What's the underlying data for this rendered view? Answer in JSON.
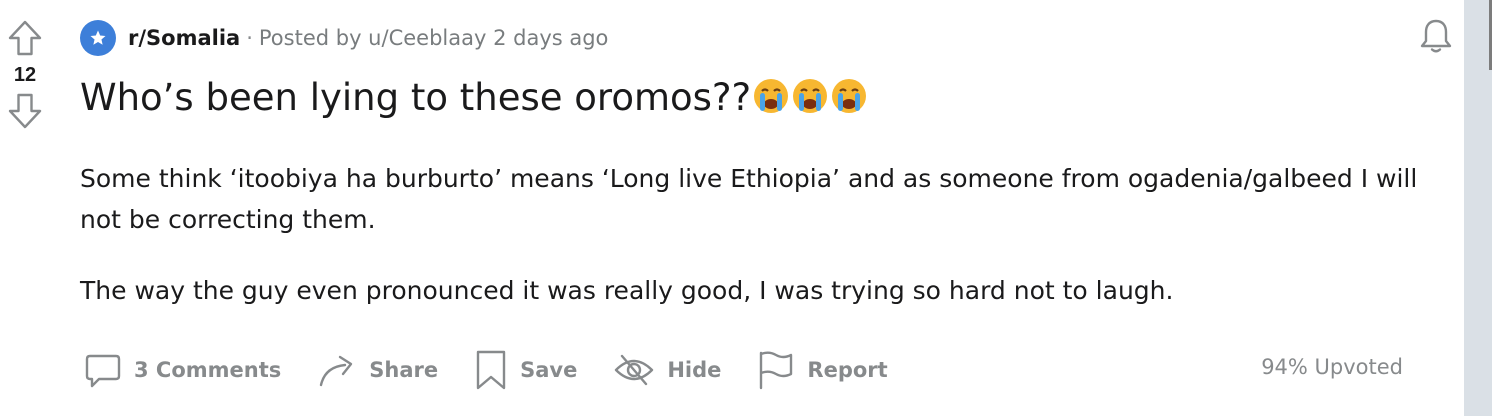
{
  "post": {
    "score": "12",
    "subreddit": "r/Somalia",
    "separator": "·",
    "posted_by": "Posted by u/Ceeblaay 2 days ago",
    "title": "Who’s been lying to these oromos??",
    "title_emojis": [
      "loudly-crying-face",
      "loudly-crying-face",
      "loudly-crying-face"
    ],
    "body": [
      "Some think ‘itoobiya ha burburto’ means ‘Long live Ethiopia’ and as someone from ogadenia/galbeed I will not be correcting them.",
      "The way the guy even pronounced it was really good, I was trying so hard not to laugh."
    ],
    "upvote_ratio": "94% Upvoted"
  },
  "actions": {
    "comments": "3 Comments",
    "share": "Share",
    "save": "Save",
    "hide": "Hide",
    "report": "Report"
  },
  "icons": {
    "upvote": "arrow-up-outline-icon",
    "downvote": "arrow-down-outline-icon",
    "subreddit_avatar": "star-icon",
    "notifications": "bell-icon",
    "comments": "comment-bubble-icon",
    "share": "share-arrow-icon",
    "save": "bookmark-icon",
    "hide": "eye-slash-icon",
    "report": "flag-icon"
  },
  "colors": {
    "subreddit_avatar": "#3d7fd9",
    "muted_text": "#878a8c",
    "text": "#1a1a1b",
    "emoji_face": "#f7b731",
    "emoji_tears": "#4aa3e8"
  }
}
